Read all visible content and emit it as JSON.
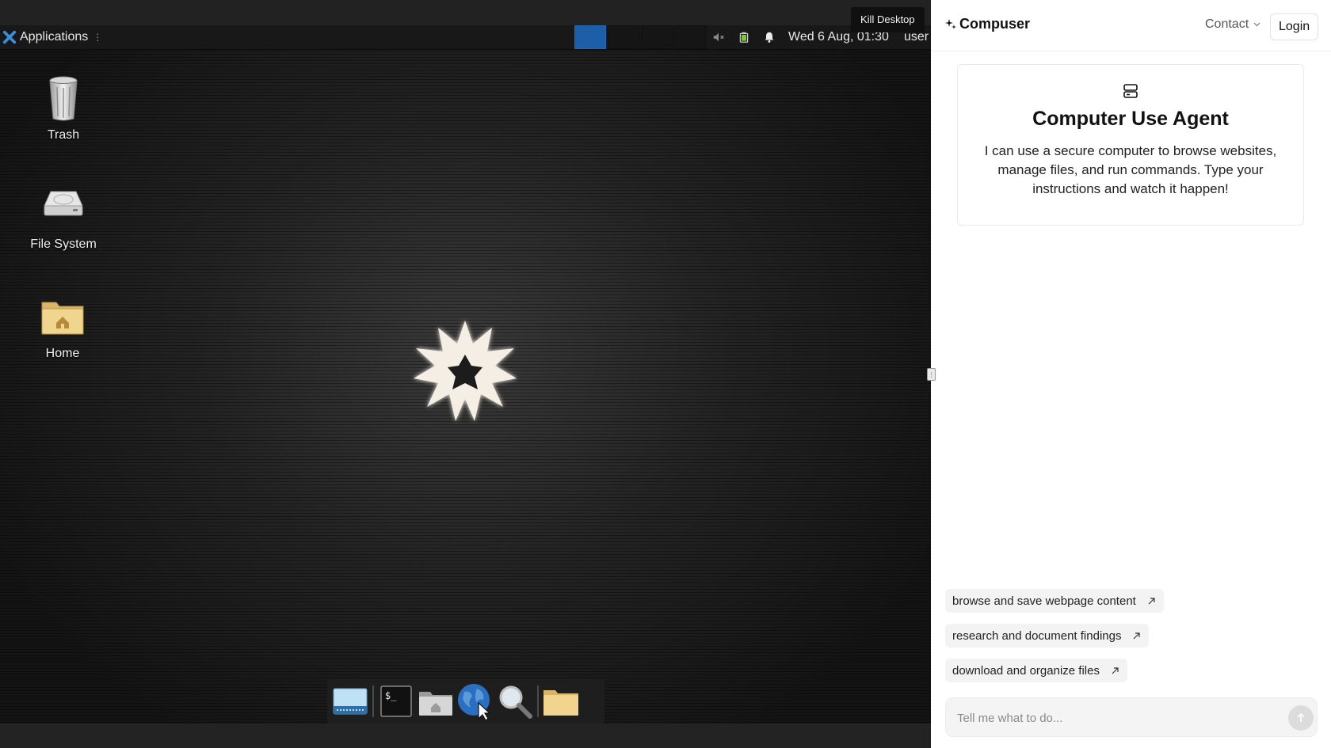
{
  "desktop": {
    "panel": {
      "applications_label": "Applications",
      "clock": "Wed  6 Aug, 01:30",
      "user": "user",
      "workspace_count": 4,
      "active_workspace": 1
    },
    "kill_button": "Kill Desktop",
    "icons": [
      {
        "label": "Trash",
        "icon": "trash-icon"
      },
      {
        "label": "File System",
        "icon": "drive-icon"
      },
      {
        "label": "Home",
        "icon": "home-folder-icon"
      }
    ],
    "dock": [
      "desktop-icon",
      "terminal-icon",
      "home-folder-icon",
      "web-browser-icon",
      "search-icon",
      "folder-icon"
    ]
  },
  "sidebar": {
    "brand": "Compuser",
    "contact": "Contact",
    "login": "Login",
    "card": {
      "title": "Computer Use Agent",
      "description": "I can use a secure computer to browse websites, manage files, and run commands. Type your instructions and watch it happen!"
    },
    "suggestions": [
      "browse and save webpage content",
      "research and document findings",
      "download and organize files"
    ],
    "input": {
      "placeholder": "Tell me what to do...",
      "value": ""
    }
  },
  "colors": {
    "active_workspace": "#1c5fa8",
    "panel_bg": "#181818",
    "chip_bg": "#f3f3f3"
  }
}
